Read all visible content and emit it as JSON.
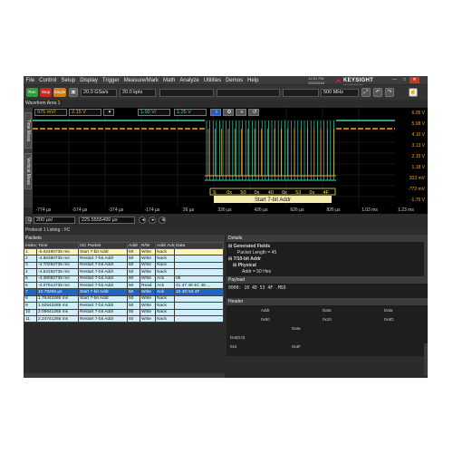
{
  "menu": [
    "File",
    "Control",
    "Setup",
    "Display",
    "Trigger",
    "Measure/Mark",
    "Math",
    "Analyze",
    "Utilities",
    "Demos",
    "Help"
  ],
  "clock": {
    "time": "12:51 PM",
    "date": "10/2/2018"
  },
  "brand": {
    "name": "KEYSIGHT",
    "sub": "TECHNOLOGIES"
  },
  "window": {
    "minimize": "—",
    "maximize": "□",
    "close": "✕"
  },
  "toolbar": {
    "run": "Run",
    "stop": "Stop",
    "single": "Single",
    "sample_rate": "20.0 GSa/s",
    "points": "20.0 kpts",
    "bandwidth": "500 MHz"
  },
  "waveform_area": {
    "title": "Waveform Area 1",
    "tabs": [
      "Time Meas",
      "Vertical Meas"
    ],
    "ch1_scale": "975 mV/",
    "ch1_offset": "2.15 V",
    "ch2_scale": "1.00 V/",
    "ch2_offset": "1.25 V",
    "y_ticks": [
      "6.05 V",
      "5.08 V",
      "4.10 V",
      "3.13 V",
      "2.15 V",
      "1.18 V",
      "203 mV",
      "-772 mV",
      "-1.75 V"
    ],
    "x_ticks": [
      "-774 µs",
      "-574 µs",
      "-374 µs",
      "-174 µs",
      "26 µs",
      "226 µs",
      "426 µs",
      "626 µs",
      "826 µs",
      "1.03 ms",
      "1.23 ms"
    ],
    "decode_labels": [
      "S",
      "0x",
      "50",
      "0x",
      "40",
      "0x",
      "53",
      "0x",
      "4F"
    ],
    "decode_banner": "Start 7-bit Addr",
    "h_scale": "200 µs/",
    "h_position": "225.5555499 µs"
  },
  "protocol": {
    "title": "Protocol 1 Listing : I²C",
    "packets_title": "Packets",
    "columns": [
      "Index",
      "Time",
      "I2C Packet",
      "Addr",
      "R/W",
      "Addr Ack",
      "Data"
    ],
    "rows": [
      {
        "style": "y",
        "cells": [
          "1",
          "-5.02490735 ms",
          "Start 7-bit Addr",
          "50",
          "Write",
          "Nack",
          ""
        ]
      },
      {
        "style": "c",
        "cells": [
          "2",
          "-4.86390735 ms",
          "Restart 7-bit Addr",
          "50",
          "Write",
          "Nack",
          ""
        ]
      },
      {
        "style": "c",
        "cells": [
          "3",
          "-4.70292735 ms",
          "Restart 7-bit Addr",
          "50",
          "Write",
          "Nack",
          ""
        ]
      },
      {
        "style": "c",
        "cells": [
          "4",
          "-4.54192735 ms",
          "Restart 7-bit Addr",
          "50",
          "Write",
          "Nack",
          ""
        ]
      },
      {
        "style": "c",
        "cells": [
          "5",
          "-4.38092735 ms",
          "Restart 7-bit Addr",
          "50",
          "Write",
          "Ack",
          "06"
        ]
      },
      {
        "style": "c",
        "cells": [
          "6",
          "-4.07514735 ms",
          "Restart 7-bit Addr",
          "50",
          "Read",
          "Ack",
          "41 47 49 4C 45 ..."
        ]
      },
      {
        "style": "sel",
        "cells": [
          "7",
          "10.79265 µs",
          "Start 7-bit Addr",
          "50",
          "Write",
          "Ack",
          "10 4D 53 4F"
        ]
      },
      {
        "style": "c",
        "cells": [
          "8",
          "1.76443265 ms",
          "Start 7-bit Addr",
          "50",
          "Write",
          "Nack",
          ""
        ]
      },
      {
        "style": "c",
        "cells": [
          "9",
          "1.92543265 ms",
          "Restart 7-bit Addr",
          "50",
          "Write",
          "Nack",
          ""
        ]
      },
      {
        "style": "c",
        "cells": [
          "10",
          "2.08641265 ms",
          "Restart 7-bit Addr",
          "50",
          "Write",
          "Nack",
          ""
        ]
      },
      {
        "style": "c",
        "cells": [
          "11",
          "2.24741265 ms",
          "Restart 7-bit Addr",
          "50",
          "Write",
          "Nack",
          ""
        ]
      }
    ]
  },
  "details": {
    "title": "Details",
    "tree": [
      {
        "indent": 0,
        "text": "⊟ Generated Fields",
        "bold": true
      },
      {
        "indent": 2,
        "text": "Packet Length = 45",
        "bold": false
      },
      {
        "indent": 0,
        "text": "⊟ 7/10-bit Addr",
        "bold": true
      },
      {
        "indent": 1,
        "text": "⊟ Physical",
        "bold": true
      },
      {
        "indent": 3,
        "text": "Addr = 50 Hex",
        "bold": false
      }
    ],
    "payload_title": "Payload",
    "payload_line": "0000:  10 4D 53 4F   .MSO",
    "header_title": "Header",
    "header_labels": [
      {
        "t": "Addr",
        "r": 0,
        "c": 1
      },
      {
        "t": "Data",
        "r": 0,
        "c": 3
      },
      {
        "t": "Data",
        "r": 0,
        "c": 5
      },
      {
        "t": "0x50",
        "r": 1,
        "c": 1
      },
      {
        "t": "0x10",
        "r": 1,
        "c": 3
      },
      {
        "t": "0x4D",
        "r": 1,
        "c": 5
      },
      {
        "t": "Data",
        "r": 2,
        "c": 2
      },
      {
        "t": "Dat(0,0)",
        "r": 3,
        "c": 0
      },
      {
        "t": "0x3",
        "r": 4,
        "c": 0
      },
      {
        "t": "0x4F",
        "r": 4,
        "c": 2
      }
    ]
  },
  "colors": {
    "ch1": "#f5a623",
    "ch2": "#3fd0b0",
    "decode": "#f0e060",
    "selected_row": "#1e66c4"
  }
}
